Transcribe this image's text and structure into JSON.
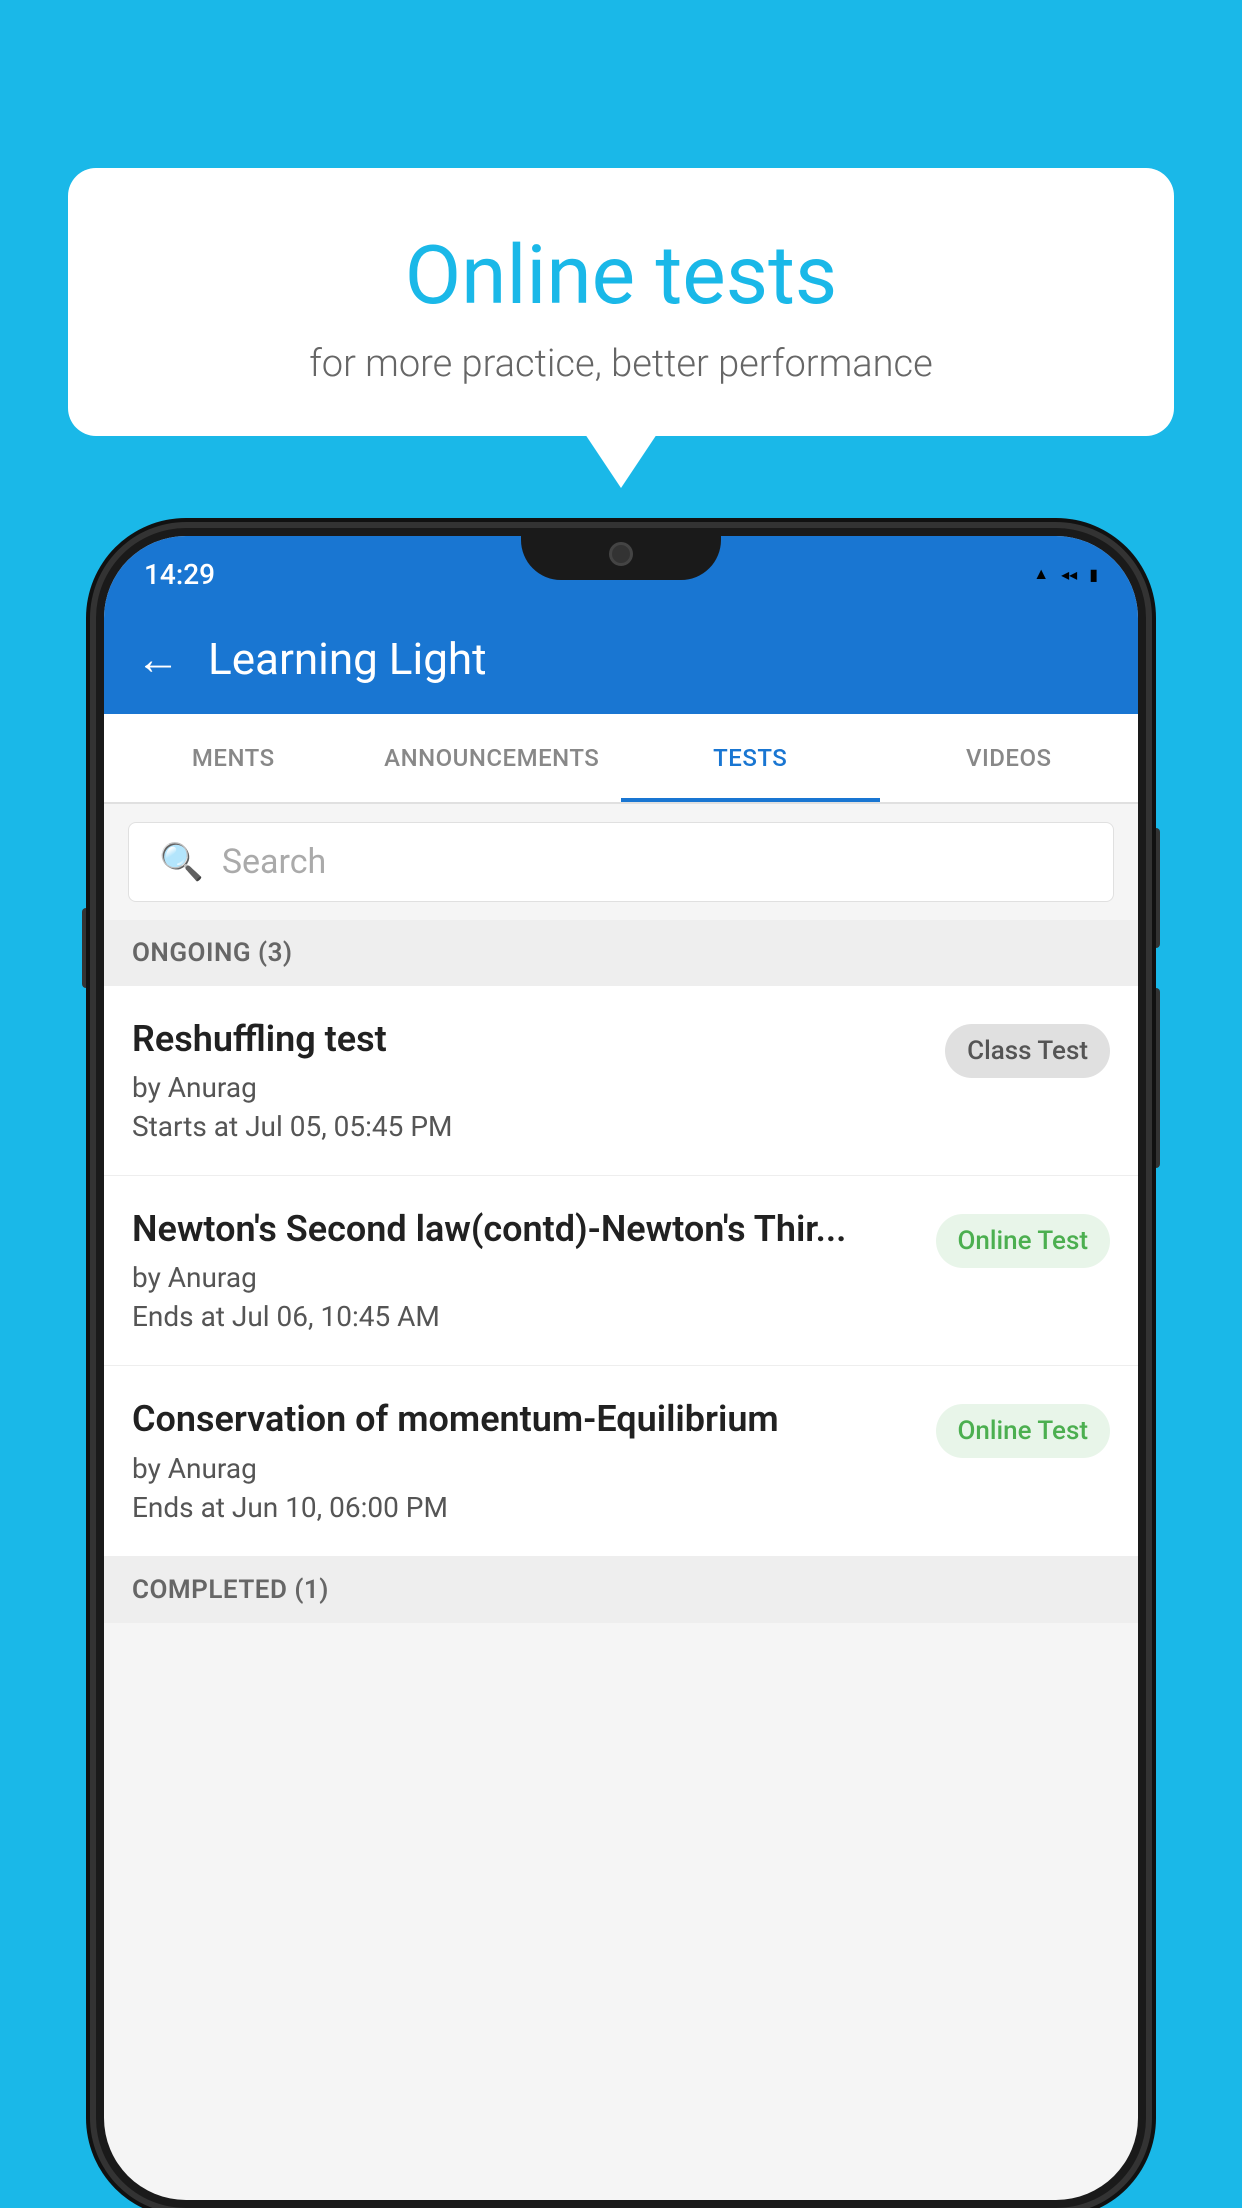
{
  "background_color": "#1ab8e8",
  "bubble": {
    "title": "Online tests",
    "subtitle": "for more practice, better performance"
  },
  "phone": {
    "status_bar": {
      "time": "14:29",
      "icons": [
        "wifi",
        "signal",
        "battery"
      ]
    },
    "header": {
      "title": "Learning Light",
      "back_label": "←"
    },
    "tabs": [
      {
        "label": "MENTS",
        "active": false
      },
      {
        "label": "ANNOUNCEMENTS",
        "active": false
      },
      {
        "label": "TESTS",
        "active": true
      },
      {
        "label": "VIDEOS",
        "active": false
      }
    ],
    "search": {
      "placeholder": "Search"
    },
    "ongoing_section": {
      "label": "ONGOING (3)"
    },
    "tests": [
      {
        "name": "Reshuffling test",
        "author": "by Anurag",
        "date": "Starts at  Jul 05, 05:45 PM",
        "badge": "Class Test",
        "badge_type": "class"
      },
      {
        "name": "Newton's Second law(contd)-Newton's Thir...",
        "author": "by Anurag",
        "date": "Ends at  Jul 06, 10:45 AM",
        "badge": "Online Test",
        "badge_type": "online"
      },
      {
        "name": "Conservation of momentum-Equilibrium",
        "author": "by Anurag",
        "date": "Ends at  Jun 10, 06:00 PM",
        "badge": "Online Test",
        "badge_type": "online"
      }
    ],
    "completed_section": {
      "label": "COMPLETED (1)"
    }
  }
}
